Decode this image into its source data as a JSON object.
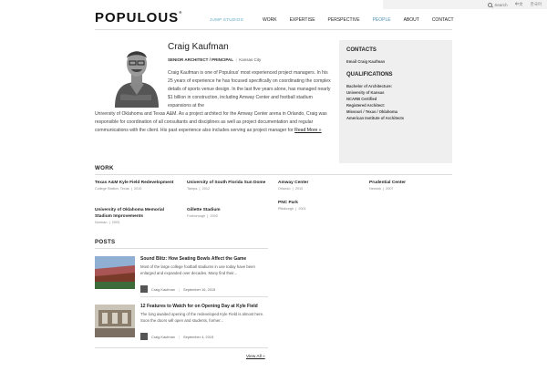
{
  "utility": {
    "search_label": "Search",
    "lang1": "中文",
    "lang2": "한국어"
  },
  "header": {
    "logo": "POPULOUS",
    "tagline": "JUMP STUDIOS",
    "nav": [
      "WORK",
      "EXPERTISE",
      "PERSPECTIVE",
      "PEOPLE",
      "ABOUT",
      "CONTACT"
    ],
    "active_nav": "PEOPLE"
  },
  "profile": {
    "name": "Craig Kaufman",
    "title": "SENIOR ARCHITECT / PRINCIPAL",
    "location": "Kansas City",
    "bio_top": "Craig Kaufman is one of Populous' most experienced project managers. In his 25 years of experience he has focused specifically on coordinating the complex details of sports venue design. In the last five years alone, has managed nearly $1 billion in construction, including Amway Center and football stadium expansions at the",
    "bio_bottom": "University of Oklahoma and Texas A&M. As a project architect for the Amway Center arena in Orlando, Craig was responsible for coordination of all consultants and disciplines as well as project documentation and regular communications with the client. His past experience also includes serving as project manager for",
    "read_more": "Read More »"
  },
  "sidebar": {
    "contacts_heading": "CONTACTS",
    "email_label": "Email Craig Kaufman",
    "qualifications_heading": "QUALIFICATIONS",
    "qualifications": [
      "Bachelor of Architecture:",
      "University of Kansas",
      "NCARB Certified",
      "Registered Architect:",
      "Missouri / Texas / Oklahoma",
      "American Institute of Architects"
    ]
  },
  "work": {
    "heading": "WORK",
    "projects": [
      {
        "title": "Texas A&M Kyle Field Redevelopment",
        "location": "College Station, Texas",
        "year": "2015"
      },
      {
        "title": "University of Oklahoma Memorial Stadium Improvements",
        "location": "Norman",
        "year": "2003"
      },
      {
        "title": "University of South Florida Sun Dome",
        "location": "Tampa",
        "year": "2012"
      },
      {
        "title": "Gillette Stadium",
        "location": "Foxborough",
        "year": "2002"
      },
      {
        "title": "Amway Center",
        "location": "Orlando",
        "year": "2010"
      },
      {
        "title": "PNC Park",
        "location": "Pittsburgh",
        "year": "2001"
      },
      {
        "title": "Prudential Center",
        "location": "Newark",
        "year": "2007"
      }
    ]
  },
  "posts": {
    "heading": "POSTS",
    "items": [
      {
        "title": "Sound Blitz: How Seating Bowls Affect the Game",
        "excerpt": "Most of the large college football stadiums in use today have been enlarged and expanded over decades. Many find their...",
        "author": "Craig Kaufman",
        "date": "September 16, 2015"
      },
      {
        "title": "12 Features to Watch for on Opening Day at Kyle Field",
        "excerpt": "The long awaited opening of the redeveloped Kyle Field is almost here.  Soon the doors will open and students, former...",
        "author": "Craig Kaufman",
        "date": "September 4, 2015"
      }
    ],
    "view_all": "View All »"
  },
  "colors": {
    "accent": "#4b8eb3",
    "tagline": "#5aa9c7",
    "sidebar_bg": "#efefef"
  }
}
